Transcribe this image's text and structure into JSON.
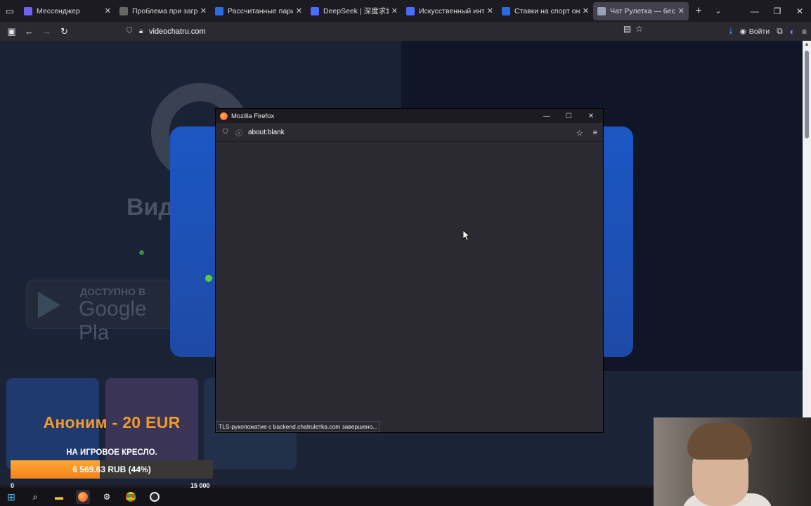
{
  "browser": {
    "tabs": [
      {
        "title": "Мессенджер",
        "favicon": "viber-icon",
        "color": "#7360f2"
      },
      {
        "title": "Проблема при загрузке с",
        "favicon": "warning-icon",
        "color": "#666666"
      },
      {
        "title": "Рассчитанные пари | БЕТ",
        "favicon": "b-icon",
        "color": "#2c6be0"
      },
      {
        "title": "DeepSeek | 深度求索",
        "favicon": "deepseek-icon",
        "color": "#4d6bfe"
      },
      {
        "title": "Искусственный интеллек",
        "favicon": "deepseek-icon",
        "color": "#4d6bfe"
      },
      {
        "title": "Ставки на спорт онлайн",
        "favicon": "b-icon",
        "color": "#2c6be0"
      },
      {
        "title": "Чат Рулетка — бесплатна",
        "favicon": "gear-icon",
        "color": "#9aa0b5",
        "active": true
      }
    ],
    "url": "videochatru.com",
    "login_label": "Войти"
  },
  "popup": {
    "title": "Mozilla Firefox",
    "url": "about:blank",
    "status": "TLS-рукопожатие с backend.chatrulетka.com завершено..."
  },
  "site": {
    "heading": "Вид",
    "google_play_small": "ДОСТУПНО В",
    "google_play_big": "Google Pla"
  },
  "donation": {
    "title": "Аноним - 20 EUR",
    "subtitle": "НА ИГРОВОЕ КРЕСЛО.",
    "progress_text": "6 569.63 RUB (44%)",
    "progress_percent": 44,
    "goal_min": "0",
    "goal_max": "15 000",
    "accent": "#f39a2b"
  }
}
